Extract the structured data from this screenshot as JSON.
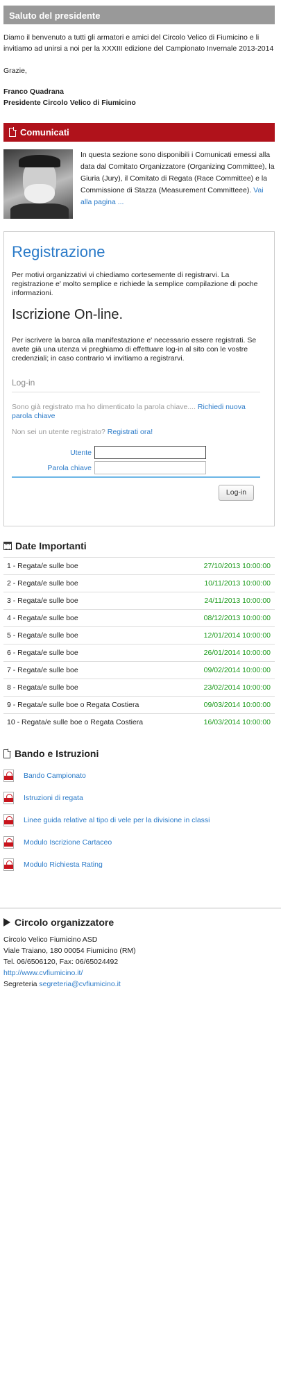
{
  "saluto": {
    "title": "Saluto del presidente",
    "text": "Diamo il benvenuto a tutti gli armatori e amici del Circolo Velico di Fiumicino e li invitiamo ad unirsi a noi per la XXXIII edizione del Campionato Invernale 2013-2014",
    "grazie": "Grazie,",
    "signature_name": "Franco Quadrana",
    "signature_role": "Presidente Circolo Velico di Fiumicino"
  },
  "comunicati": {
    "title": "Comunicati",
    "text": "In questa sezione sono disponibili i Comunicati emessi alla data dal Comitato Organizzatore (Organizing Committee), la Giuria (Jury), il Comitato di Regata (Race Committee) e la Commissione di Stazza (Measurement Committeee).",
    "link": "Vai alla pagina ..."
  },
  "registrazione": {
    "title": "Registrazione",
    "intro": "Per motivi organizzativi vi chiediamo cortesemente di registrarvi. La registrazione e' molto semplice e richiede la semplice compilazione di poche informazioni.",
    "online_title": "Iscrizione On-line.",
    "online_text": "Per iscrivere la barca alla manifestazione e' necessario essere registrati. Se avete già una utenza vi preghiamo di effettuare log-in al sito con le vostre credenziali; in caso contrario vi invitiamo a registrarvi.",
    "login_heading": "Log-in",
    "forgot_text": "Sono già registrato ma ho dimenticato la parola chiave.... ",
    "forgot_link": "Richiedi nuova parola chiave",
    "not_registered_text": "Non sei un utente registrato? ",
    "register_link": "Registrati ora!",
    "user_label": "Utente",
    "password_label": "Parola chiave",
    "user_value": "",
    "password_value": "",
    "login_button": "Log-in"
  },
  "date_importanti": {
    "title": "Date Importanti",
    "rows": [
      {
        "label": "1 - Regata/e sulle boe",
        "date": "27/10/2013 10:00:00"
      },
      {
        "label": "2 - Regata/e sulle boe",
        "date": "10/11/2013 10:00:00"
      },
      {
        "label": "3 - Regata/e sulle boe",
        "date": "24/11/2013 10:00:00"
      },
      {
        "label": "4 - Regata/e sulle boe",
        "date": "08/12/2013 10:00:00"
      },
      {
        "label": "5 - Regata/e sulle boe",
        "date": "12/01/2014 10:00:00"
      },
      {
        "label": "6 - Regata/e sulle boe",
        "date": "26/01/2014 10:00:00"
      },
      {
        "label": "7 - Regata/e sulle boe",
        "date": "09/02/2014 10:00:00"
      },
      {
        "label": "8 - Regata/e sulle boe",
        "date": "23/02/2014 10:00:00"
      },
      {
        "label": "9 - Regata/e sulle boe o Regata Costiera",
        "date": "09/03/2014 10:00:00"
      },
      {
        "label": "10 - Regata/e sulle boe o Regata Costiera",
        "date": "16/03/2014 10:00:00"
      }
    ]
  },
  "bando": {
    "title": "Bando e Istruzioni",
    "items": [
      {
        "label": "Bando Campionato"
      },
      {
        "label": "Istruzioni di regata"
      },
      {
        "label": "Linee guida relative al tipo di vele per la divisione in classi"
      },
      {
        "label": "Modulo Iscrizione Cartaceo"
      },
      {
        "label": "Modulo Richiesta Rating"
      }
    ]
  },
  "circolo": {
    "title": "Circolo organizzatore",
    "name": "Circolo Velico Fiumicino ASD",
    "address": "Viale Traiano, 180 00054 Fiumicino (RM)",
    "phone": "Tel. 06/6506120, Fax: 06/65024492",
    "website": "http://www.cvfiumicino.it/",
    "email_label": "Segreteria ",
    "email": "segreteria@cvfiumicino.it"
  },
  "colors": {
    "accent_blue": "#2a7ac8",
    "header_red": "#b0121b",
    "header_grey": "#999999",
    "date_green": "#1a9a1a"
  }
}
